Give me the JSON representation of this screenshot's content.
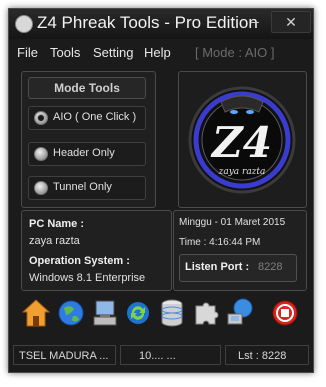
{
  "window": {
    "title": "Z4 Phreak Tools - Pro Edition",
    "minimize_glyph": "–",
    "close_glyph": "✕"
  },
  "menu": {
    "file": "File",
    "tools": "Tools",
    "setting": "Setting",
    "help": "Help",
    "mode": "[ Mode : AIO ]"
  },
  "mode_tools": {
    "title": "Mode Tools",
    "options": [
      {
        "label": "AIO ( One Click )",
        "selected": true
      },
      {
        "label": "Header Only",
        "selected": false
      },
      {
        "label": "Tunnel Only",
        "selected": false
      }
    ]
  },
  "logo": {
    "text": "Z4",
    "caption": "zaya razta"
  },
  "system": {
    "pc_name_label": "PC Name :",
    "pc_name": "zaya razta",
    "os_label": "Operation System :",
    "os": "Windows 8.1 Enterprise"
  },
  "datetime": {
    "date": "Minggu - 01 Maret 2015",
    "time": "Time : 4:16:44 PM",
    "listen_port_label": "Listen Port :",
    "listen_port": "8228"
  },
  "toolbar": [
    "home-icon",
    "globe-icon",
    "computer-icon",
    "refresh-icon",
    "database-icon",
    "puzzle-icon",
    "network-icon",
    "stop-icon"
  ],
  "status": {
    "carrier": "TSEL MADURA ...",
    "ip": "10.... ...",
    "listen": "Lst : 8228"
  }
}
